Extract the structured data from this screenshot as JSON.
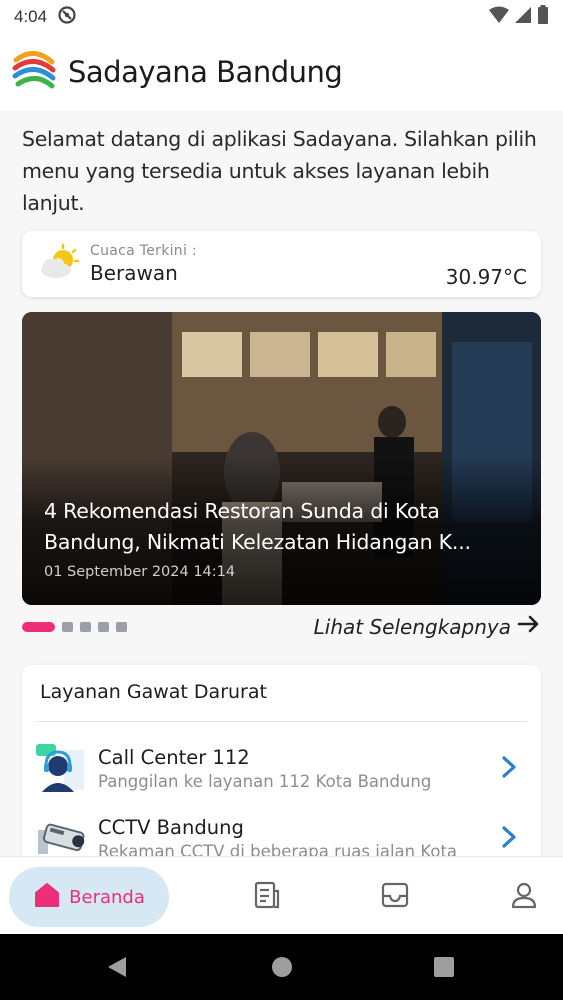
{
  "status_bar": {
    "time": "4:04",
    "icons": [
      "sync-icon",
      "wifi-icon",
      "signal-icon",
      "battery-icon"
    ]
  },
  "header": {
    "app_title": "Sadayana Bandung",
    "logo": "sadayana-logo"
  },
  "welcome_text": "Selamat datang di aplikasi Sadayana. Silahkan pilih menu yang tersedia untuk akses layanan lebih lanjut.",
  "weather": {
    "label": "Cuaca Terkini :",
    "condition": "Berawan",
    "temperature": "30.97°C",
    "icon": "partly-cloudy-icon"
  },
  "news_carousel": {
    "title_line1": "4 Rekomendasi Restoran Sunda di Kota",
    "title_line2": "Bandung, Nikmati Kelezatan Hidangan K...",
    "date": "01 September 2024 14:14",
    "slide_count": 5,
    "active_index": 0,
    "see_more": "Lihat Selengkapnya"
  },
  "emergency": {
    "section_title": "Layanan Gawat Darurat",
    "items": [
      {
        "title": "Call Center 112",
        "subtitle": "Panggilan ke layanan 112 Kota Bandung",
        "icon": "call-center-icon"
      },
      {
        "title": "CCTV Bandung",
        "subtitle": "Rekaman CCTV di beberapa ruas jalan Kota",
        "icon": "cctv-camera-icon"
      }
    ]
  },
  "bottom_nav": {
    "items": [
      {
        "label": "Beranda",
        "icon": "home-icon",
        "active": true
      },
      {
        "label": "",
        "icon": "news-icon",
        "active": false
      },
      {
        "label": "",
        "icon": "inbox-icon",
        "active": false
      },
      {
        "label": "",
        "icon": "profile-icon",
        "active": false
      }
    ]
  },
  "colors": {
    "accent_pink": "#ec2f78",
    "active_nav_bg": "#d6e8f3",
    "chevron_blue": "#2f7fd1"
  }
}
